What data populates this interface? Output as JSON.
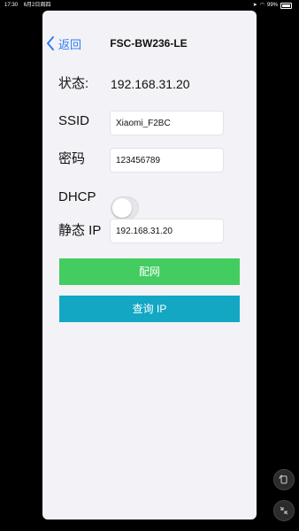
{
  "status_bar": {
    "time": "17:30",
    "date": "6月2日周四",
    "battery": "99%"
  },
  "nav": {
    "back_label": "返回",
    "title": "FSC-BW236-LE"
  },
  "form": {
    "status_label": "状态:",
    "status_value": "192.168.31.20",
    "ssid_label": "SSID",
    "ssid_value": "Xiaomi_F2BC",
    "password_label": "密码",
    "password_value": "123456789",
    "dhcp_label": "DHCP",
    "dhcp_enabled": false,
    "static_ip_label": "静态 IP",
    "static_ip_value": "192.168.31.20"
  },
  "buttons": {
    "configure_label": "配网",
    "query_ip_label": "查询 IP"
  },
  "colors": {
    "accent_blue": "#2f7cf6",
    "configure_green": "#43cd61",
    "query_teal": "#13a7c4",
    "background": "#f2f2f7"
  }
}
